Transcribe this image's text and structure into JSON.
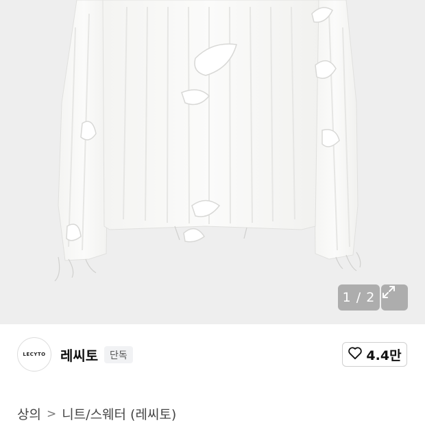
{
  "hero": {
    "image_alt": "white distressed knit sweater",
    "counter": "1 / 2",
    "background": "#eeeeee"
  },
  "brand": {
    "logo_text": "LECYTO",
    "name": "레씨토",
    "badge": "단독"
  },
  "like": {
    "count": "4.4만",
    "icon": "heart-icon"
  },
  "breadcrumb": {
    "category": "상의",
    "separator": ">",
    "subcategory": "니트/스웨터 (레씨토)"
  }
}
